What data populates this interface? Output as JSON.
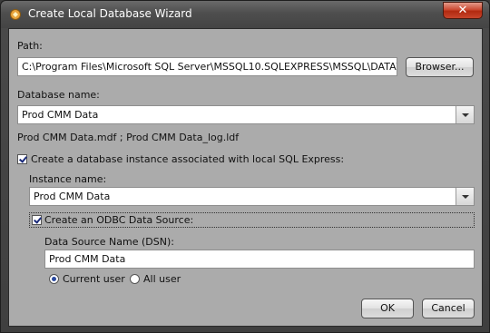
{
  "window": {
    "title": "Create Local Database Wizard",
    "close_glyph": "✕"
  },
  "path": {
    "label": "Path:",
    "value": "C:\\Program Files\\Microsoft SQL Server\\MSSQL10.SQLEXPRESS\\MSSQL\\DATA\\",
    "browse_button": "Browser..."
  },
  "database": {
    "label": "Database name:",
    "value": "Prod CMM Data",
    "files_text": "Prod CMM Data.mdf ;  Prod CMM Data_log.ldf"
  },
  "instance_option": {
    "checked": true,
    "label": "Create a database instance associated with local SQL Express:"
  },
  "instance": {
    "label": "Instance name:",
    "value": "Prod CMM Data"
  },
  "odbc_option": {
    "checked": true,
    "label": "Create an ODBC Data Source:"
  },
  "dsn": {
    "label": "Data Source Name (DSN):",
    "value": "Prod CMM Data"
  },
  "scope": {
    "options": [
      {
        "label": "Current user",
        "selected": true
      },
      {
        "label": "All user",
        "selected": false
      }
    ]
  },
  "buttons": {
    "ok": "OK",
    "cancel": "Cancel"
  },
  "colors": {
    "client_background": "#ababab",
    "frame": "#444444",
    "close_button": "#c8452c"
  },
  "icons": {
    "app": "wizard-icon",
    "close": "close-icon",
    "dropdown": "chevron-down-icon"
  }
}
